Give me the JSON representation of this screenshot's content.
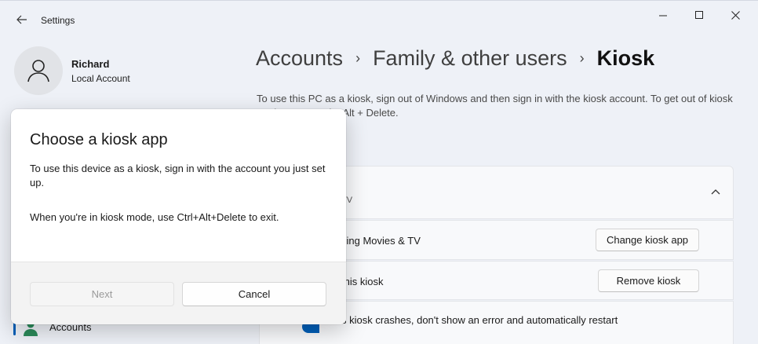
{
  "app": {
    "title": "Settings"
  },
  "user": {
    "name": "Richard",
    "account_type": "Local Account"
  },
  "sidebar": {
    "accounts_label": "Accounts"
  },
  "breadcrumb": {
    "items": [
      "Accounts",
      "Family & other users"
    ],
    "current": "Kiosk"
  },
  "main": {
    "description": "To use this PC as a kiosk, sign out of Windows and then sign in with the kiosk account. To get out of kiosk mode, press Ctrl + Alt + Delete.",
    "card_subtitle": "TV",
    "row1_text": "sing Movies & TV",
    "change_app_button": "Change kiosk app",
    "row2_text": "this kiosk",
    "remove_button": "Remove kiosk",
    "row3_text": "s kiosk crashes, don't show an error and automatically restart"
  },
  "dialog": {
    "title": "Choose a kiosk app",
    "paragraph1": "To use this device as a kiosk, sign in with the account you just set up.",
    "paragraph2": "When you're in kiosk mode, use Ctrl+Alt+Delete to exit.",
    "next_label": "Next",
    "cancel_label": "Cancel"
  },
  "colors": {
    "accent": "#005fb8",
    "window_bg": "#eef1f7",
    "dialog_bg": "#ffffff",
    "dialog_footer_bg": "#f3f3f3"
  },
  "icons": [
    "back-arrow-icon",
    "minimize-icon",
    "maximize-icon",
    "close-icon",
    "person-icon",
    "chevron-up-icon",
    "accounts-icon"
  ]
}
